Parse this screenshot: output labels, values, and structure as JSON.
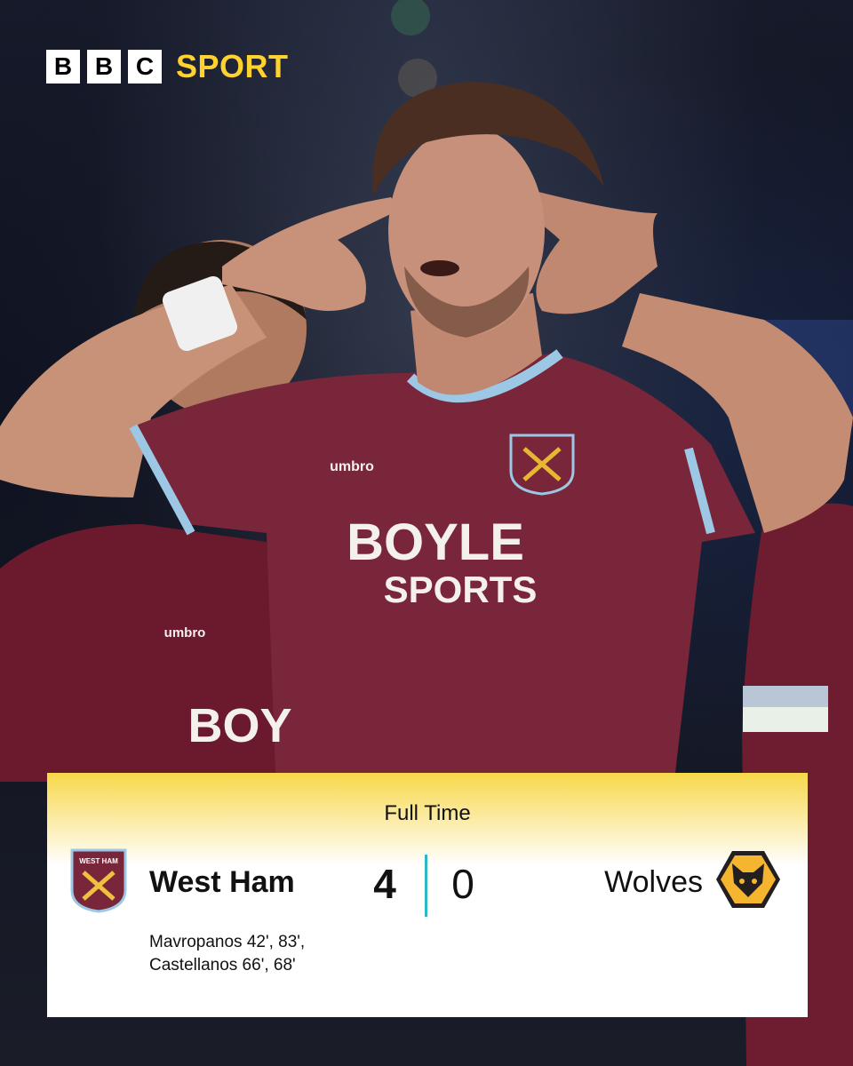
{
  "brand": {
    "letters": [
      "B",
      "B",
      "C"
    ],
    "section": "SPORT"
  },
  "photo": {
    "jersey_color": "#7a1f35",
    "sponsor_line1": "BOYLE",
    "sponsor_line2": "SPORTS",
    "teammate_sponsor": "BOY",
    "kit_maker": "umbro",
    "crest_text": "WEST HAM"
  },
  "match": {
    "status": "Full Time",
    "home": {
      "name": "West Ham",
      "score": "4",
      "crest": "west-ham-crest-icon"
    },
    "away": {
      "name": "Wolves",
      "score": "0",
      "crest": "wolves-crest-icon"
    },
    "scorers": {
      "line1": "Mavropanos 42', 83',",
      "line2": "Castellanos 66', 68'"
    }
  },
  "colors": {
    "accent_yellow": "#ffd230",
    "divider": "#2ab7c6",
    "claret": "#7a263a",
    "sky_blue": "#9cc8e6",
    "wolves_gold": "#f5b52e"
  }
}
